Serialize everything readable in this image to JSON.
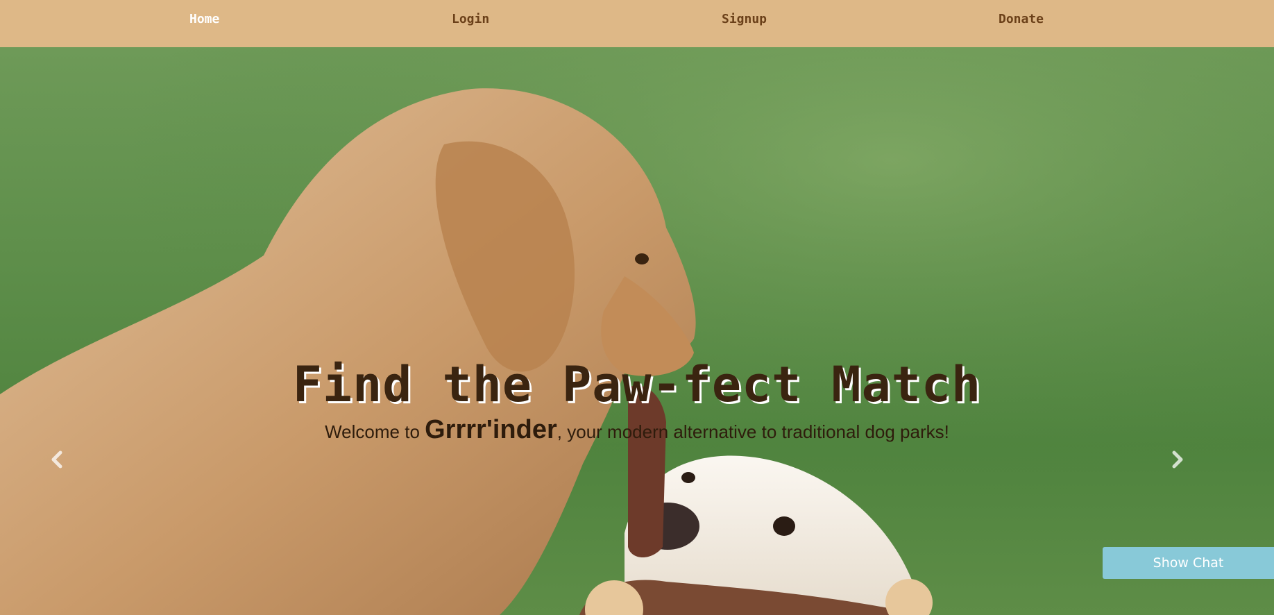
{
  "nav": {
    "items": [
      {
        "label": "Home",
        "active": true
      },
      {
        "label": "Login",
        "active": false
      },
      {
        "label": "Signup",
        "active": false
      },
      {
        "label": "Donate",
        "active": false
      }
    ]
  },
  "hero": {
    "headline": "Find the Paw-fect Match",
    "subline_prefix": "Welcome to ",
    "brand": "Grrrr'inder",
    "subline_suffix": ", your modern alternative to traditional dog parks!",
    "prev_icon": "chevron-left-icon",
    "next_icon": "chevron-right-icon"
  },
  "chat": {
    "label": "Show Chat"
  },
  "colors": {
    "navbar": "#deb887",
    "nav_text": "#6b4019",
    "nav_active": "#ffffff",
    "headline": "#3a2410",
    "chat_button": "#88c9d8"
  }
}
